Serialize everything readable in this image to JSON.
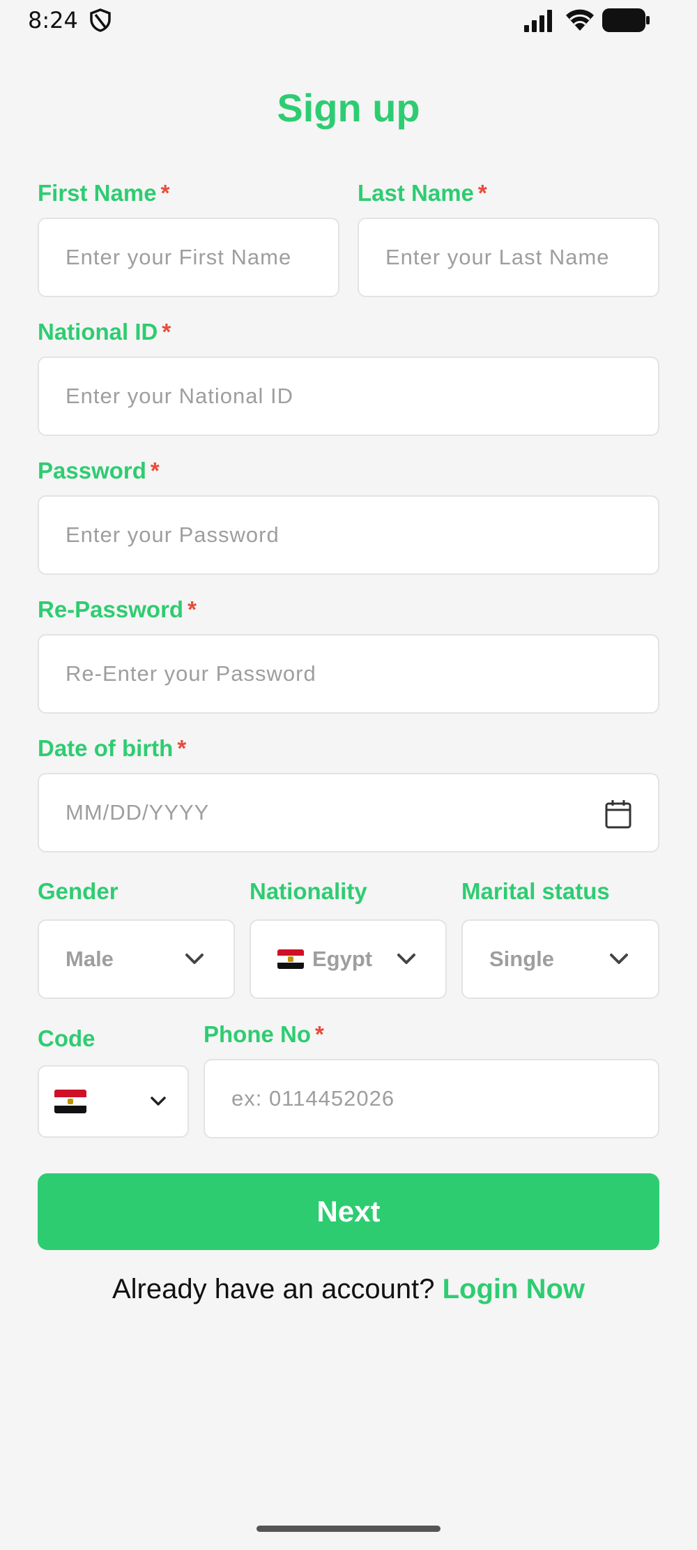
{
  "status_bar": {
    "time": "8:24",
    "icons": [
      "shield-icon",
      "signal-icon",
      "wifi-icon",
      "battery-icon"
    ]
  },
  "title": "Sign up",
  "required_marker": "*",
  "form": {
    "first_name": {
      "label": "First Name",
      "placeholder": "Enter your First Name"
    },
    "last_name": {
      "label": "Last Name",
      "placeholder": "Enter your Last Name"
    },
    "national_id": {
      "label": "National ID",
      "placeholder": "Enter your National ID"
    },
    "password": {
      "label": "Password",
      "placeholder": "Enter your Password"
    },
    "re_password": {
      "label": "Re-Password",
      "placeholder": "Re-Enter your Password"
    },
    "dob": {
      "label": "Date of birth",
      "placeholder": "MM/DD/YYYY"
    },
    "gender": {
      "label": "Gender",
      "value": "Male"
    },
    "nationality": {
      "label": "Nationality",
      "value": "Egypt"
    },
    "marital_status": {
      "label": "Marital status",
      "value": "Single"
    },
    "code": {
      "label": "Code"
    },
    "phone": {
      "label": "Phone No",
      "placeholder": "ex: 0114452026"
    }
  },
  "next_button": "Next",
  "footer": {
    "prompt": "Already have an account?",
    "link": "Login Now"
  },
  "colors": {
    "accent": "#2ecc71",
    "required": "#e74c3c",
    "background": "#f5f5f5"
  }
}
